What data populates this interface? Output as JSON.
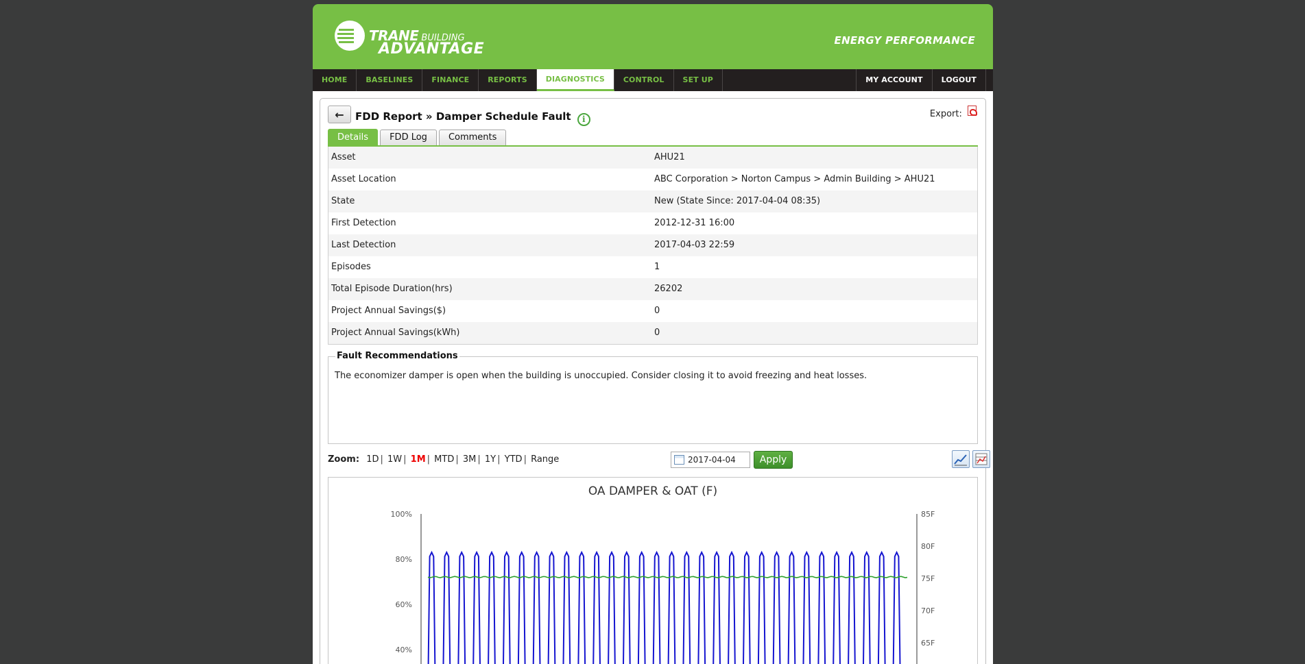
{
  "header": {
    "brand_line1": "TRANE",
    "brand_line1_small": "BUILDING",
    "brand_line2": "ADVANTAGE",
    "product": "ENERGY PERFORMANCE",
    "accent_color": "#77bf45"
  },
  "nav": {
    "items": [
      {
        "label": "HOME"
      },
      {
        "label": "BASELINES"
      },
      {
        "label": "FINANCE"
      },
      {
        "label": "REPORTS"
      },
      {
        "label": "DIAGNOSTICS",
        "active": true
      },
      {
        "label": "CONTROL"
      },
      {
        "label": "SET UP"
      }
    ],
    "right": [
      {
        "label": "MY ACCOUNT"
      },
      {
        "label": "LOGOUT"
      }
    ]
  },
  "page": {
    "back_icon": "back-arrow-icon",
    "title": "FDD Report » Damper Schedule Fault",
    "info_glyph": "i",
    "export_label": "Export:",
    "export_icon": "pdf-icon"
  },
  "tabs": [
    {
      "label": "Details",
      "active": true
    },
    {
      "label": "FDD Log"
    },
    {
      "label": "Comments"
    }
  ],
  "details": [
    {
      "key": "Asset",
      "value": "AHU21"
    },
    {
      "key": "Asset Location",
      "value": "ABC Corporation > Norton Campus > Admin Building > AHU21"
    },
    {
      "key": "State",
      "value": "New (State Since: 2017-04-04 08:35)"
    },
    {
      "key": "First Detection",
      "value": "2012-12-31 16:00"
    },
    {
      "key": "Last Detection",
      "value": "2017-04-03 22:59"
    },
    {
      "key": "Episodes",
      "value": "1"
    },
    {
      "key": "Total Episode Duration(hrs)",
      "value": "26202"
    },
    {
      "key": "Project Annual Savings($)",
      "value": "0"
    },
    {
      "key": "Project Annual Savings(kWh)",
      "value": "0"
    }
  ],
  "recommendations": {
    "legend": "Fault Recommendations",
    "text": "The economizer damper is open when the building is unoccupied. Consider closing it to avoid freezing and heat losses."
  },
  "zoom": {
    "label": "Zoom:",
    "options": [
      "1D",
      "1W",
      "1M",
      "MTD",
      "3M",
      "1Y",
      "YTD",
      "Range"
    ],
    "selected": "1M",
    "date": "2017-04-04",
    "apply_label": "Apply"
  },
  "chart_data": {
    "type": "line",
    "title": "OA DAMPER & OAT (F)",
    "y_left_ticks": [
      "100%",
      "80%",
      "60%",
      "40%"
    ],
    "y_right_ticks": [
      "85F",
      "80F",
      "75F",
      "70F",
      "65F"
    ],
    "ylim_left": [
      40,
      100
    ],
    "ylim_right": [
      65,
      85
    ],
    "series": [
      {
        "axis": "left",
        "color": "#1515d0",
        "pattern": "daily cycle",
        "cycles": 32,
        "peak": 83,
        "trough": 0
      },
      {
        "axis": "right",
        "color": "#2ca02c",
        "pattern": "flat",
        "value": 75.2
      }
    ]
  }
}
